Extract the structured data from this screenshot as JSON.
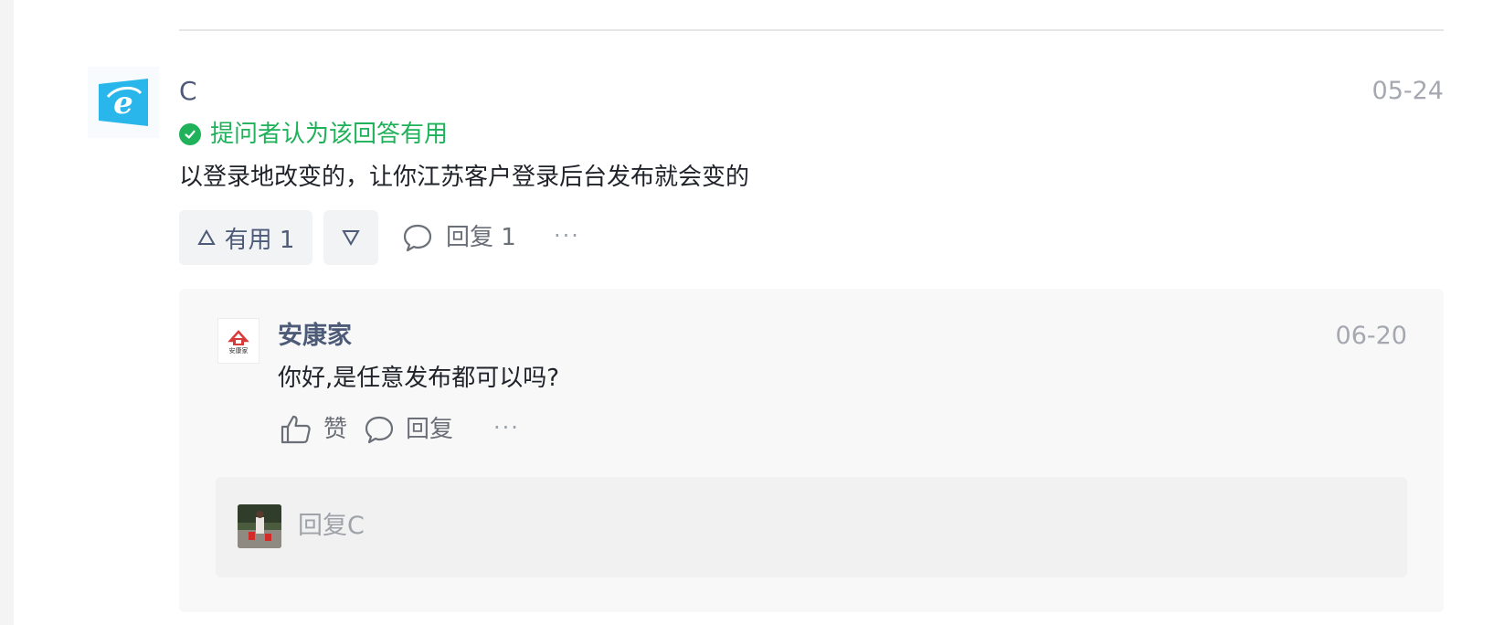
{
  "answer": {
    "author": "C",
    "date": "05-24",
    "useful_badge": "提问者认为该回答有用",
    "text": "以登录地改变的，让你江苏客户登录后台发布就会变的",
    "useful_label": "有用 1",
    "reply_label": "回复 1",
    "more_label": "···"
  },
  "reply": {
    "avatar_caption": "安康家",
    "author": "安康家",
    "date": "06-20",
    "text": "你好,是任意发布都可以吗?",
    "like_label": "赞",
    "reply_label": "回复",
    "more_label": "···"
  },
  "reply_input": {
    "placeholder": "回复C"
  },
  "colors": {
    "accent_green": "#1fb25a",
    "name_blue": "#4d5a78",
    "meta_gray": "#a5a8b0"
  },
  "icons": [
    "ie-logo-icon",
    "check-circle-icon",
    "triangle-up-icon",
    "triangle-down-icon",
    "comment-icon",
    "thumbs-up-icon",
    "more-icon"
  ]
}
